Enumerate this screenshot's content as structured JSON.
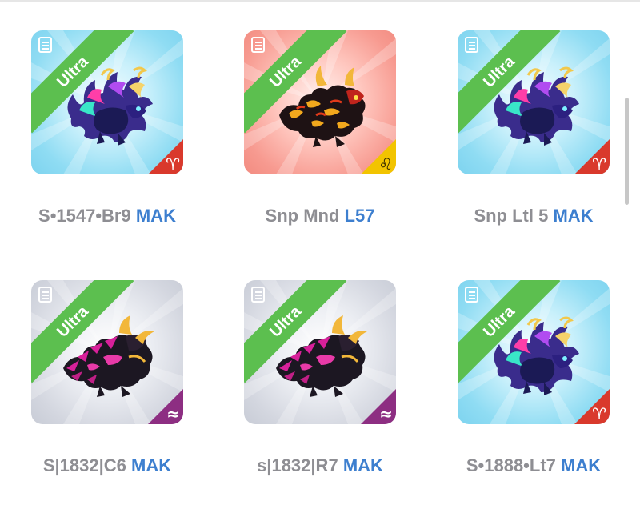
{
  "colors": {
    "ribbon": "#5cbf4f",
    "bg_blue": "#8fdcf3",
    "bg_red": "#f79a90",
    "bg_grey": "#d3d6df",
    "caption_grey": "#8e8e93",
    "caption_blue": "#3d7fcf",
    "corner_red": "#d9392c",
    "corner_yellow": "#f2c400",
    "corner_purple": "#8d2e82"
  },
  "cards": [
    {
      "ribbon": "Ultra",
      "name": "S•1547•Br9",
      "tag": "MAK",
      "badge": "♈",
      "badge_icon": "aries-icon",
      "creature": "blue-purple-spiky-creature"
    },
    {
      "ribbon": "Ultra",
      "name": "Snp Mnd",
      "tag": "L57",
      "badge": "♌",
      "badge_icon": "leo-icon",
      "creature": "red-black-lava-creature"
    },
    {
      "ribbon": "Ultra",
      "name": "Snp Ltl 5",
      "tag": "MAK",
      "badge": "♈",
      "badge_icon": "aries-icon",
      "creature": "blue-purple-spiky-creature"
    },
    {
      "ribbon": "Ultra",
      "name": "S|1832|C6",
      "tag": "MAK",
      "badge": "≈",
      "badge_icon": "aquarius-icon",
      "creature": "pink-black-spiky-creature"
    },
    {
      "ribbon": "Ultra",
      "name": "s|1832|R7",
      "tag": "MAK",
      "badge": "≈",
      "badge_icon": "aquarius-icon",
      "creature": "pink-black-spiky-creature"
    },
    {
      "ribbon": "Ultra",
      "name": "S•1888•Lt7",
      "tag": "MAK",
      "badge": "♈",
      "badge_icon": "aries-icon",
      "creature": "blue-purple-spiky-creature"
    }
  ]
}
